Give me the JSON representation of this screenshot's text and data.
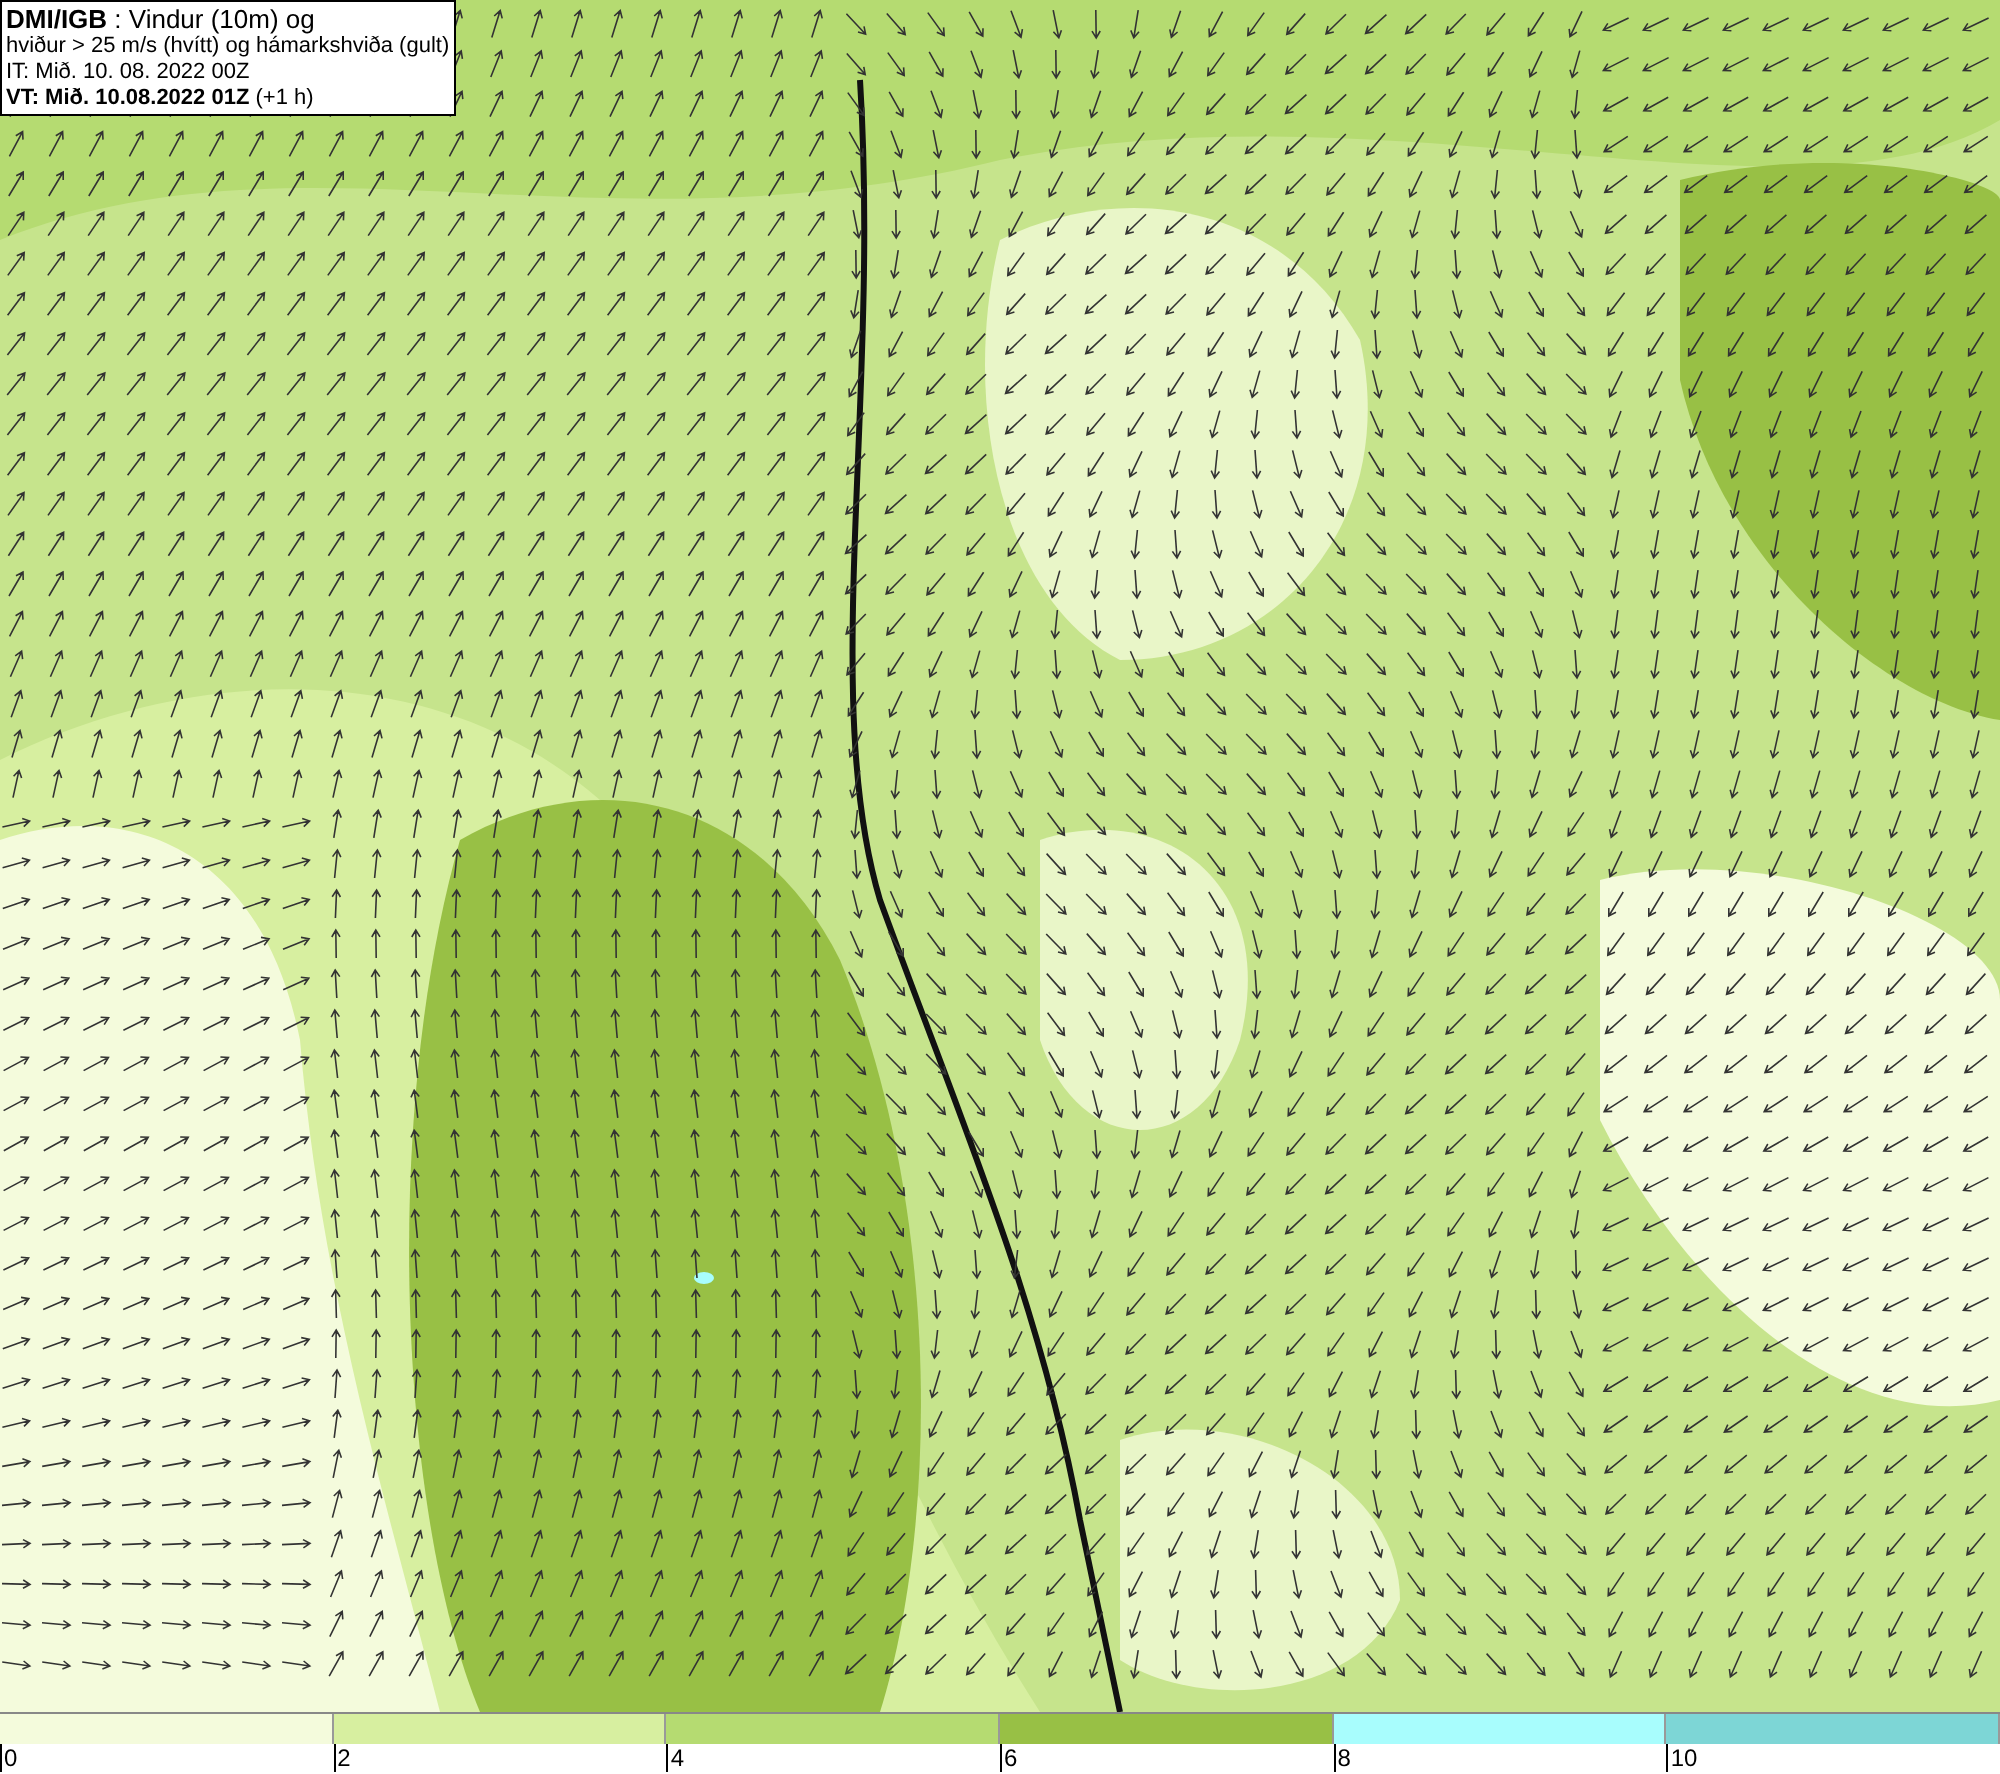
{
  "info_box": {
    "lines": [
      "**DMI/IGB** : Vindur (10m) og",
      "hviður > 25 m/s (hvítt) og hámarkshviða (gult)",
      "IT: Mið. 10. 08. 2022 00Z",
      "**VT: Mið. 10.08.2022 01Z** (+1 h)"
    ]
  },
  "color_scale": [
    {
      "label": "0",
      "color": "#f4fbdc"
    },
    {
      "label": "2",
      "color": "#d7efa0"
    },
    {
      "label": "4",
      "color": "#b5db71"
    },
    {
      "label": "6",
      "color": "#98c045"
    },
    {
      "label": "8",
      "color": "#a8fdfd"
    },
    {
      "label": "10",
      "color": "#7dd6d6"
    }
  ]
}
